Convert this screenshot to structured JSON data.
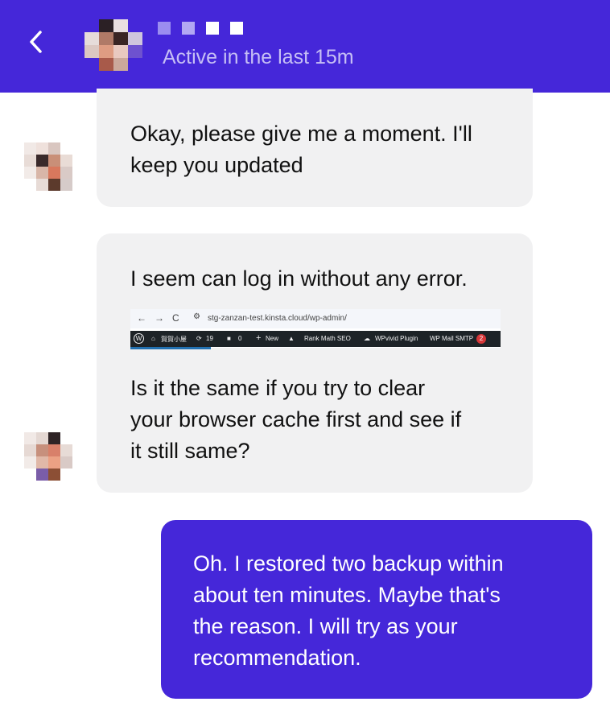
{
  "header": {
    "status": "Active in the last 15m",
    "back_icon": "chevron-left-icon"
  },
  "messages": [
    {
      "from": "agent",
      "lines": [
        "Okay, please give me a moment. I'll",
        "keep you updated"
      ]
    },
    {
      "from": "agent",
      "text_top": "I seem can log in without any error.",
      "screenshot": {
        "url": "stg-zanzan-test.kinsta.cloud/wp-admin/",
        "site_name": "賀賀小屋",
        "updates_count": "19",
        "comments_count": "0",
        "new_label": "New",
        "rank_math_label": "Rank Math SEO",
        "wpvivid_label": "WPvivid Plugin",
        "wpmail_label": "WP Mail SMTP",
        "wpmail_badge": "2"
      },
      "lines_bottom": [
        "Is it the same if you try to clear",
        "your browser cache first and see if",
        "it still same?"
      ]
    },
    {
      "from": "user",
      "lines": [
        "Oh. I restored two backup within",
        "about ten minutes. Maybe that's",
        "the reason. I will try as your",
        "recommendation."
      ]
    }
  ],
  "colors": {
    "brand": "#4527d9",
    "incoming_bubble": "#f1f1f2",
    "status_text": "#c6bff5"
  }
}
